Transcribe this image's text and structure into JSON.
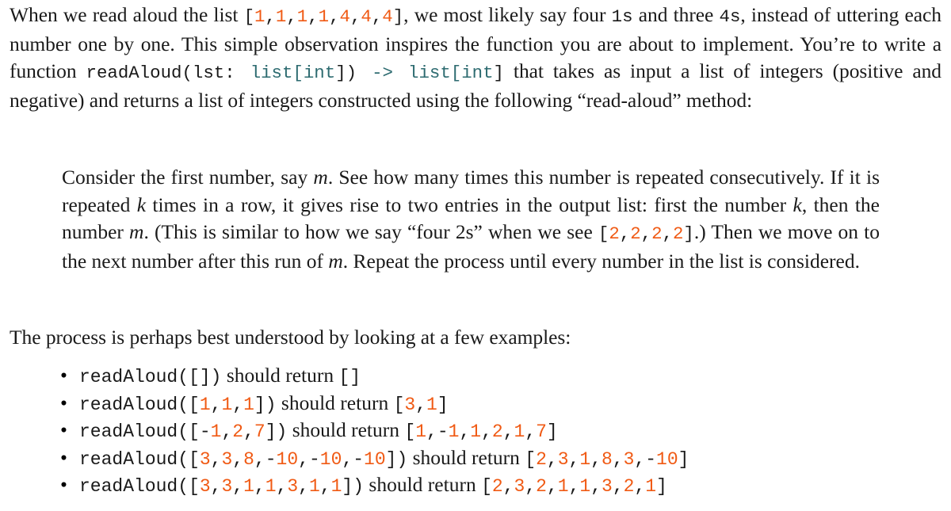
{
  "document": {
    "intro": {
      "s1": "When we read aloud the list ",
      "list_literal_1": {
        "open": "[",
        "values": [
          1,
          1,
          1,
          1,
          4,
          4,
          4
        ],
        "close": "]"
      },
      "s2": ", we most likely say four ",
      "mono_1s": "1s",
      "s3": " and three ",
      "mono_4s": "4s",
      "s4": ", instead of uttering each number one by one. This simple observation inspires the function you are about to implement. You’re to write a function ",
      "signature": {
        "name": "readAloud",
        "open_paren": "(",
        "param": "lst",
        "colon": ": ",
        "param_type_open": "list[",
        "param_type_inner": "int",
        "param_type_close": "]",
        "close_paren": ")",
        "arrow": " -> ",
        "return_type_open": "list[",
        "return_type_inner": "int",
        "return_type_close": "]"
      },
      "s5": " that takes as input a list of integers (positive and negative) and returns a list of integers constructed using the following “read-aloud” method:"
    },
    "quote": {
      "q1": "Consider the first number, say ",
      "var_m_1": "m",
      "q2": ". See how many times this number is repeated consecutively. If it is repeated ",
      "var_k_1": "k",
      "q3": " times in a row, it gives rise to two entries in the output list: first the number ",
      "var_k_2": "k",
      "q4": ", then the number ",
      "var_m_2": "m",
      "q5": ". (This is similar to how we say “four 2s” when we see ",
      "list_literal_2": {
        "open": "[",
        "values": [
          2,
          2,
          2,
          2
        ],
        "close": "]"
      },
      "q6": ".) Then we move on to the next number after this run of ",
      "var_m_3": "m",
      "q7": ". Repeat the process until every number in the list is considered."
    },
    "examples_lead": "The process is perhaps best understood by looking at a few examples:",
    "bullet_glyph": "•",
    "connector": " should return ",
    "function_name": "readAloud",
    "examples": [
      {
        "input": [],
        "output": []
      },
      {
        "input": [
          1,
          1,
          1
        ],
        "output": [
          3,
          1
        ]
      },
      {
        "input": [
          -1,
          2,
          7
        ],
        "output": [
          1,
          -1,
          1,
          2,
          1,
          7
        ]
      },
      {
        "input": [
          3,
          3,
          8,
          -10,
          -10,
          -10
        ],
        "output": [
          2,
          3,
          1,
          8,
          3,
          -10
        ]
      },
      {
        "input": [
          3,
          3,
          1,
          1,
          3,
          1,
          1
        ],
        "output": [
          2,
          3,
          2,
          1,
          1,
          3,
          2,
          1
        ]
      }
    ],
    "colors": {
      "text": "#1a1a1a",
      "number_literal": "#f05a14",
      "type_keyword": "#2d6b70",
      "background": "#ffffff"
    }
  }
}
